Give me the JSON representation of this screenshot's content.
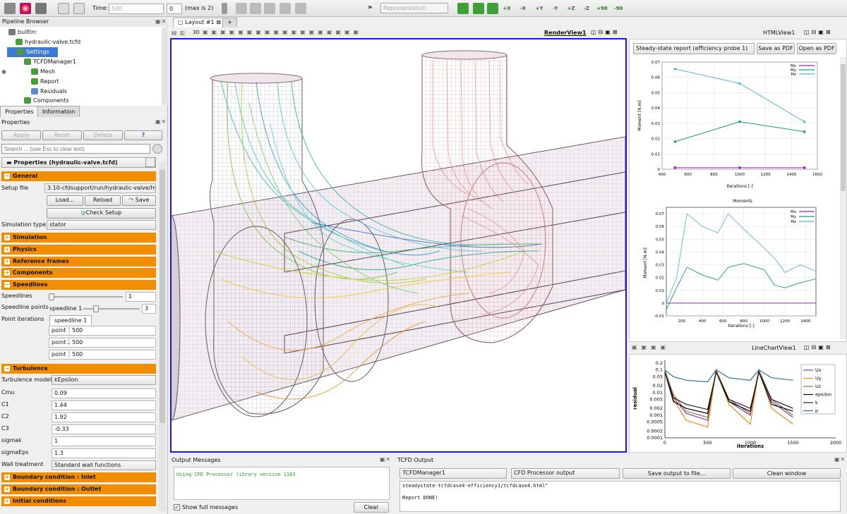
{
  "toolbar": {
    "time_label": "Time:",
    "time_value": "500",
    "timestep_value": "0",
    "timestep_max": "(max is 2)",
    "more_label": "»",
    "representation": "Representation",
    "camera_labels": [
      "+X",
      "-X",
      "+Y",
      "-Y",
      "+Z",
      "-Z",
      "+90",
      "-90"
    ]
  },
  "pipeline": {
    "title": "Pipeline Browser",
    "items": [
      {
        "label": "builtin:"
      },
      {
        "label": "hydraulic-valve.tcfd"
      },
      {
        "label": "Settings"
      },
      {
        "label": "TCFDManager1"
      },
      {
        "label": "Mesh"
      },
      {
        "label": "Report"
      },
      {
        "label": "Residuals"
      },
      {
        "label": "Components"
      }
    ]
  },
  "properties": {
    "tabs": [
      "Properties",
      "Information"
    ],
    "title": "Properties",
    "apply": "Apply",
    "reset": "Reset",
    "delete": "Delete",
    "help": "?",
    "search_placeholder": "Search ... (use Esc to clear text)",
    "header": "Properties (hydraulic-valve.tcfd)",
    "general": "General",
    "setup_file_label": "Setup file",
    "setup_file_value": "3.10-cfdsupport/run/hydraulic-valve/hydr",
    "load": "Load...",
    "reload": "Reload",
    "save": "Save",
    "check_setup": "Check Setup",
    "simulation_type_label": "Simulation type",
    "simulation_type_value": "stator",
    "sections_a": [
      "Simulation",
      "Physics",
      "Reference frames",
      "Components",
      "Speedlines"
    ],
    "speedlines_label": "Speedlines",
    "speedlines_value": "1",
    "speedline_points_label": "Speedline points",
    "speedline_sel": "speedline 1",
    "speedline_points_value": "3",
    "point_iterations_label": "Point iterations",
    "speedline_tab": "speedline 1",
    "points": [
      {
        "label": "point 1",
        "value": "500"
      },
      {
        "label": "point 2",
        "value": "500"
      },
      {
        "label": "point 3",
        "value": "500"
      }
    ],
    "turbulence": "Turbulence",
    "turb_fields": [
      {
        "label": "Turbulence model",
        "value": "kEpsilon"
      },
      {
        "label": "Cmu",
        "value": "0.09"
      },
      {
        "label": "C1",
        "value": "1.44"
      },
      {
        "label": "C2",
        "value": "1.92"
      },
      {
        "label": "C3",
        "value": "-0.33"
      },
      {
        "label": "sigmak",
        "value": "1"
      },
      {
        "label": "sigmaEps",
        "value": "1.3"
      },
      {
        "label": "Wall treatment",
        "value": "Standard wall functions"
      }
    ],
    "sections_b": [
      "Boundary condition : Inlet",
      "Boundary condition : Outlet",
      "Initial conditions"
    ]
  },
  "layout": {
    "tab": "Layout #1",
    "add_tab": "+",
    "view_3d": "3D",
    "render_view": "RenderView1",
    "html_view": "HTMLView1",
    "linechart_view": "LineChartView1"
  },
  "html_view": {
    "report_select": "Steady-state report (efficiency probe 1)",
    "save_pdf": "Save as PDF",
    "open_pdf": "Open as PDF"
  },
  "moments_chart": {
    "ylabel": "Moment [N.m]",
    "xlabel": "Iterations [-]",
    "yticks": [
      "0.07",
      "0.06",
      "0.05",
      "0.04",
      "0.03",
      "0.02",
      "0.01",
      "0"
    ],
    "xticks": [
      "400",
      "600",
      "800",
      "1000",
      "1200",
      "1400",
      "1600"
    ],
    "legend": [
      "Mx",
      "My",
      "Mz"
    ]
  },
  "moments_history": {
    "title": "Moments",
    "ylabel": "Moment [N.m]",
    "xlabel": "Iterations [-]",
    "yticks": [
      "0.07",
      "0.06",
      "0.05",
      "0.04",
      "0.03",
      "0.02",
      "0.01",
      "0",
      "-0.01"
    ],
    "xticks": [
      "200",
      "400",
      "600",
      "800",
      "1000",
      "1200",
      "1400"
    ],
    "legend": [
      "Mx",
      "My",
      "Mz"
    ]
  },
  "residuals_chart": {
    "ylabel": "residual",
    "xlabel": "iterations",
    "yticks": [
      "0.2",
      "0.1",
      "0.05",
      "0.02",
      "0.01",
      "0.005",
      "0.002",
      "0.001",
      "0.0005",
      "0.0002",
      "0.0001"
    ],
    "xticks": [
      "0",
      "500",
      "1000",
      "1500",
      "2000"
    ],
    "legend": [
      "Ux",
      "Uy",
      "Uz",
      "epsilon",
      "k",
      "p"
    ]
  },
  "output_messages": {
    "title": "Output Messages",
    "text": "Using CFD Processor library version  1183",
    "show_full": "Show full messages",
    "clear": "Clear"
  },
  "tcfd_output": {
    "title": "TCFD Output",
    "manager": "TCFDManager1",
    "source": "CFD Processor output",
    "save": "Save output to file...",
    "clean": "Clean window",
    "line1": "steadystate-tcfdcase4-efficiency1/tcfdcase4.html\"",
    "line2": "Report DONE!"
  },
  "chart_data": [
    {
      "type": "line",
      "title": "",
      "xlabel": "Iterations [-]",
      "ylabel": "Moment [N.m]",
      "xlim": [
        400,
        1600
      ],
      "ylim": [
        0,
        0.07
      ],
      "x": [
        500,
        1000,
        1500
      ],
      "series": [
        {
          "name": "Mx",
          "values": [
            0.001,
            0.001,
            0.001
          ]
        },
        {
          "name": "My",
          "values": [
            0.018,
            0.031,
            0.0245
          ]
        },
        {
          "name": "Mz",
          "values": [
            0.0655,
            0.056,
            0.031
          ]
        }
      ],
      "legend": "top-right",
      "grid": true
    },
    {
      "type": "line",
      "title": "Moments",
      "xlabel": "Iterations [-]",
      "ylabel": "Moment [N.m]",
      "xlim": [
        50,
        1500
      ],
      "ylim": [
        -0.01,
        0.075
      ],
      "x": [
        50,
        150,
        250,
        400,
        550,
        650,
        800,
        1000,
        1100,
        1200,
        1350,
        1500
      ],
      "series": [
        {
          "name": "Mx",
          "values": [
            0,
            0,
            0,
            0,
            0,
            0,
            0,
            0,
            0,
            0,
            0,
            0
          ]
        },
        {
          "name": "My",
          "values": [
            -0.005,
            0.012,
            0.028,
            0.022,
            0.018,
            0.028,
            0.031,
            0.026,
            0.014,
            0.012,
            0.016,
            0.019
          ]
        },
        {
          "name": "Mz",
          "values": [
            0.0,
            0.02,
            0.07,
            0.06,
            0.055,
            0.07,
            0.058,
            0.043,
            0.035,
            0.024,
            0.03,
            0.025
          ]
        }
      ],
      "legend": "top-right",
      "grid": true
    },
    {
      "type": "line",
      "title": "",
      "xlabel": "iterations",
      "ylabel": "residual",
      "xlim": [
        0,
        2000
      ],
      "ylim": [
        0.0001,
        0.2
      ],
      "yscale": "log",
      "x": [
        0,
        100,
        250,
        500,
        600,
        750,
        1000,
        1100,
        1250,
        1500
      ],
      "series": [
        {
          "name": "Ux",
          "values": [
            0.1,
            0.006,
            0.0012,
            0.0006,
            0.1,
            0.004,
            0.001,
            0.1,
            0.004,
            0.0008
          ]
        },
        {
          "name": "Uy",
          "values": [
            0.1,
            0.005,
            0.0006,
            0.0003,
            0.1,
            0.003,
            0.0004,
            0.1,
            0.002,
            0.0004
          ]
        },
        {
          "name": "Uz",
          "values": [
            0.1,
            0.008,
            0.0015,
            0.0008,
            0.1,
            0.005,
            0.0012,
            0.1,
            0.005,
            0.001
          ]
        },
        {
          "name": "epsilon",
          "values": [
            0.08,
            0.004,
            0.002,
            0.0012,
            0.08,
            0.004,
            0.0015,
            0.08,
            0.003,
            0.0015
          ]
        },
        {
          "name": "k",
          "values": [
            0.08,
            0.006,
            0.003,
            0.0018,
            0.08,
            0.005,
            0.002,
            0.08,
            0.005,
            0.002
          ]
        },
        {
          "name": "p",
          "values": [
            0.1,
            0.05,
            0.035,
            0.03,
            0.1,
            0.045,
            0.035,
            0.1,
            0.045,
            0.035
          ]
        }
      ],
      "legend": "top-right",
      "grid": false
    }
  ],
  "colors": {
    "section_orange": "#f18e00",
    "selection_blue": "#3b7bd4",
    "active_view_border": "#1a1ad8",
    "Mx": "#9b1fbf",
    "My": "#1b9a7a",
    "Mz": "#5bb4e0",
    "Ux": "#7a3fb0",
    "Uy": "#f28a10",
    "Uz": "#a07040",
    "epsilon": "#000000",
    "k": "#222222",
    "p": "#2d6fa6"
  }
}
